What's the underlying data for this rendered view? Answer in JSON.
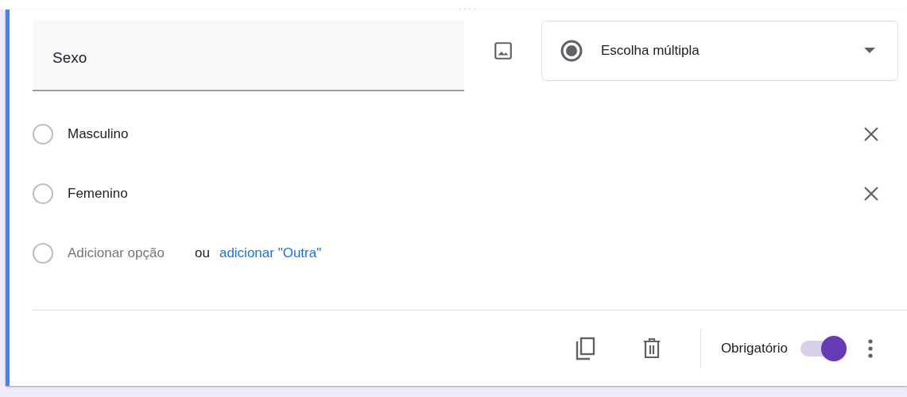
{
  "question": {
    "title": "Sexo",
    "type": {
      "label": "Escolha múltipla"
    }
  },
  "options": [
    {
      "label": "Masculino"
    },
    {
      "label": "Femenino"
    }
  ],
  "add_option": {
    "placeholder": "Adicionar opção",
    "separator": "ou",
    "link": "adicionar \"Outra\""
  },
  "footer": {
    "required_label": "Obrigatório",
    "required": true
  }
}
